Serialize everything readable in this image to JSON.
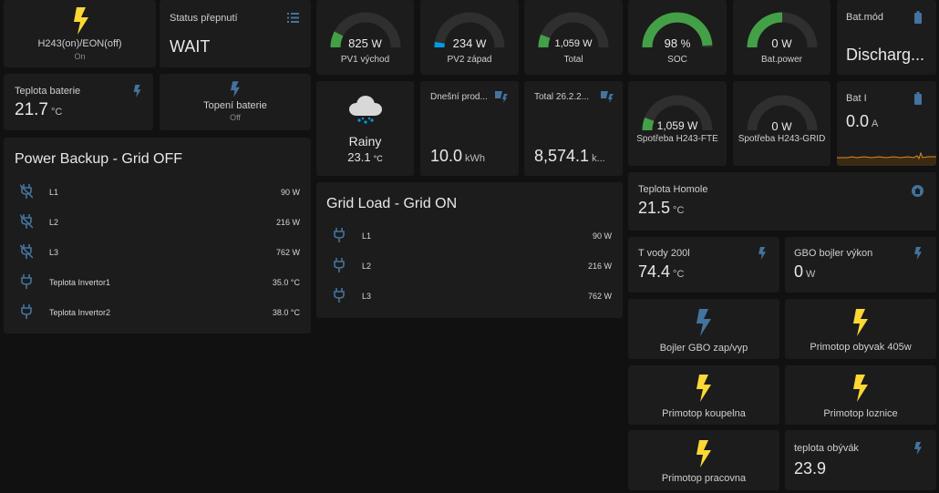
{
  "colors": {
    "background": "#111111",
    "card": "#1c1c1c",
    "bolt_on": "#fdd835",
    "bolt_off": "#44739e",
    "gauge_green": "#43a047",
    "gauge_blue": "#039be5",
    "gauge_track": "#2f2f2f"
  },
  "switch_h243": {
    "name": "H243(on)/EON(off)",
    "state": "On",
    "icon": "lightning-bolt-icon"
  },
  "status_switch": {
    "name": "Status přepnutí",
    "value": "WAIT",
    "icon": "list-icon"
  },
  "teplota_baterie": {
    "name": "Teplota baterie",
    "value": "21.7",
    "unit": "°C",
    "icon": "lightning-bolt-icon"
  },
  "topeni_baterie": {
    "name": "Topení baterie",
    "state": "Off",
    "icon": "lightning-bolt-icon"
  },
  "power_backup": {
    "title": "Power Backup - Grid OFF",
    "rows": [
      {
        "name": "L1",
        "value": "90 W",
        "icon": "power-plug-off-icon"
      },
      {
        "name": "L2",
        "value": "216 W",
        "icon": "power-plug-off-icon"
      },
      {
        "name": "L3",
        "value": "762 W",
        "icon": "power-plug-off-icon"
      },
      {
        "name": "Teplota Invertor1",
        "value": "35.0 °C",
        "icon": "power-plug-icon"
      },
      {
        "name": "Teplota Invertor2",
        "value": "38.0 °C",
        "icon": "power-plug-icon"
      }
    ]
  },
  "gauges": {
    "pv1": {
      "value": "825",
      "unit": "W",
      "name": "PV1 východ",
      "fraction": 0.15,
      "color": "#43a047"
    },
    "pv2": {
      "value": "234",
      "unit": "W",
      "name": "PV2 západ",
      "fraction": 0.05,
      "color": "#039be5"
    },
    "total": {
      "value": "1,059",
      "unit": "W",
      "name": "Total",
      "fraction": 0.12,
      "color": "#43a047"
    },
    "soc": {
      "value": "98",
      "unit": "%",
      "name": "SOC",
      "fraction": 0.98,
      "color": "#43a047"
    },
    "batpower": {
      "value": "0",
      "unit": "W",
      "name": "Bat.power",
      "fraction": 0.5,
      "color": "#43a047"
    },
    "spotreba_fte": {
      "value": "1,059",
      "unit": "W",
      "name": "Spotřeba H243-FTE",
      "fraction": 0.12,
      "color": "#43a047"
    },
    "spotreba_grid": {
      "value": "0",
      "unit": "W",
      "name": "Spotřeba H243-GRID",
      "fraction": 0.0,
      "color": "#43a047"
    }
  },
  "bat_mod": {
    "name": "Bat.mód",
    "value": "Discharg...",
    "icon": "battery-icon"
  },
  "weather": {
    "condition": "Rainy",
    "temp": "23.1",
    "unit": "°C",
    "icon": "cloud-rain-icon"
  },
  "dnesni_prod": {
    "name": "Dnešní prod...",
    "value": "10.0",
    "unit": "kWh",
    "icon": "solar-power-icon"
  },
  "total_26": {
    "name": "Total 26.2.2...",
    "value": "8,574.1",
    "unit": "k...",
    "icon": "solar-power-icon"
  },
  "bat_i": {
    "name": "Bat I",
    "value": "0.0",
    "unit": "A",
    "icon": "battery-icon"
  },
  "grid_load": {
    "title": "Grid Load - Grid ON",
    "rows": [
      {
        "name": "L1",
        "value": "90 W",
        "icon": "power-plug-icon"
      },
      {
        "name": "L2",
        "value": "216 W",
        "icon": "power-plug-icon"
      },
      {
        "name": "L3",
        "value": "762 W",
        "icon": "power-plug-icon"
      }
    ]
  },
  "teplota_homole": {
    "name": "Teplota Homole",
    "value": "21.5",
    "unit": "°C",
    "icon": "home-assistant-icon"
  },
  "t_vody": {
    "name": "T vody 200l",
    "value": "74.4",
    "unit": "°C",
    "icon": "lightning-bolt-icon"
  },
  "gbo_bojler_vykon": {
    "name": "GBO bojler výkon",
    "value": "0",
    "unit": "W",
    "icon": "lightning-bolt-icon"
  },
  "buttons": {
    "bojler_gbo": {
      "name": "Bojler GBO zap/vyp",
      "icon": "lightning-bolt-icon",
      "on": false
    },
    "primotop_obyvak": {
      "name": "Primotop obyvak 405w",
      "icon": "lightning-bolt-icon",
      "on": true
    },
    "primotop_koupelna": {
      "name": "Primotop koupelna",
      "icon": "lightning-bolt-icon",
      "on": true
    },
    "primotop_loznice": {
      "name": "Primotop loznice",
      "icon": "lightning-bolt-icon",
      "on": true
    },
    "primotop_pracovna": {
      "name": "Primotop pracovna",
      "icon": "lightning-bolt-icon",
      "on": true
    }
  },
  "teplota_obyvak": {
    "name": "teplota obývák",
    "value": "23.9",
    "icon": "lightning-bolt-icon"
  }
}
